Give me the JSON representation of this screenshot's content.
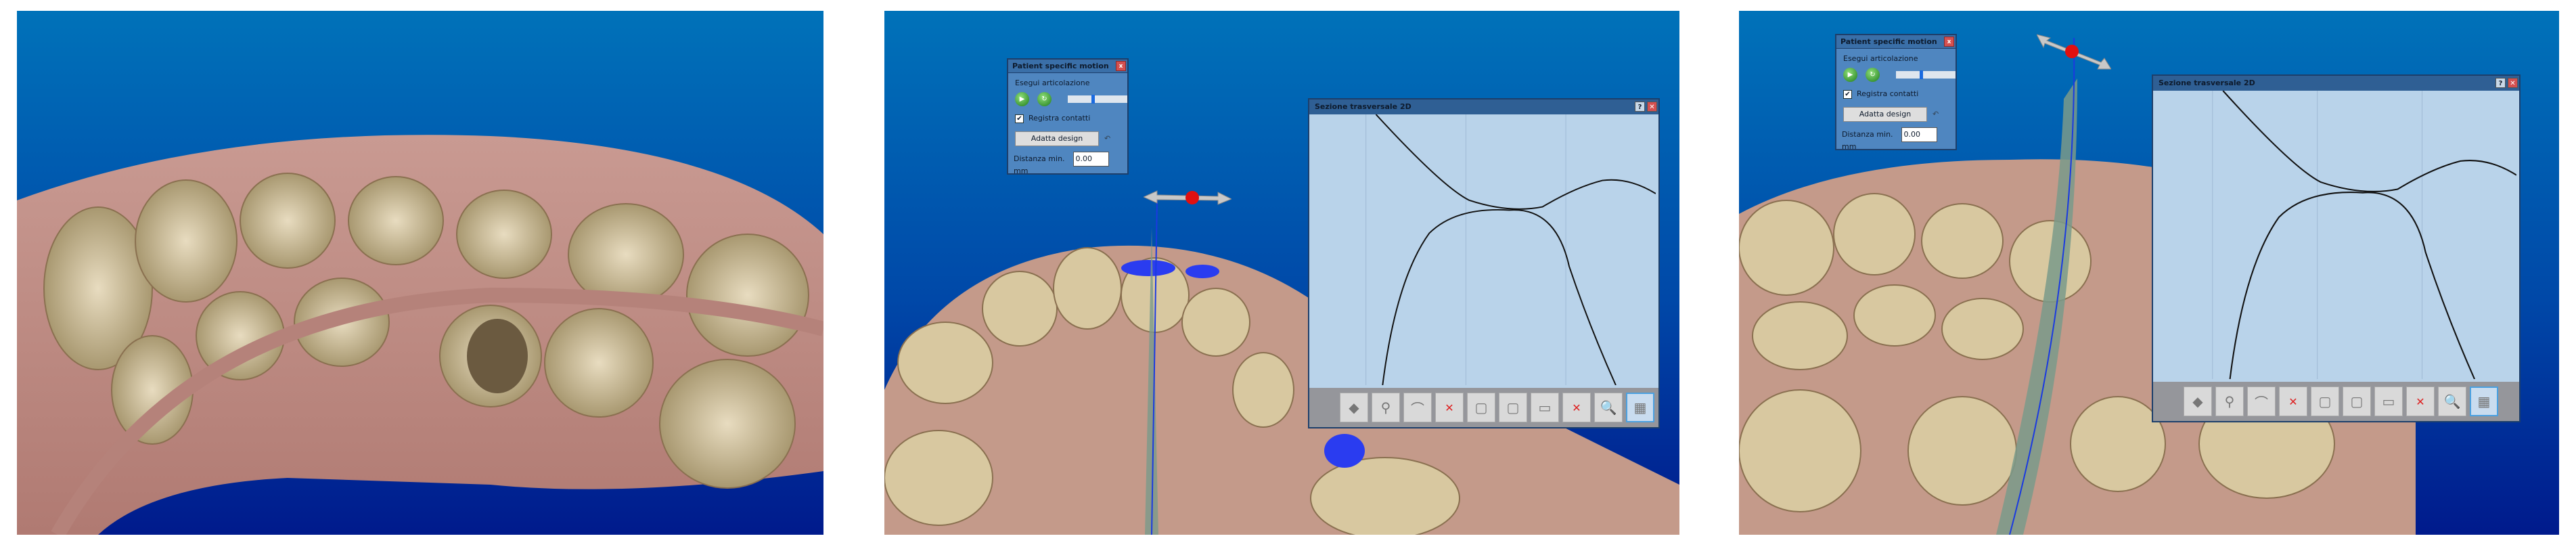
{
  "panels": [
    {
      "name": "occlusal-view"
    },
    {
      "name": "motion-view"
    },
    {
      "name": "motion-view-2"
    }
  ],
  "motion_dialog": {
    "title": "Patient specific motion",
    "close": "x",
    "section_label": "Esegui articolazione",
    "play_icon": "play-icon",
    "reset_icon": "refresh-icon",
    "slider_value": 0.4,
    "checkbox_label": "Registra contatti",
    "checkbox_checked": true,
    "adapt_button": "Adatta design",
    "distance_label": "Distanza min.",
    "distance_value": "0.00",
    "unit": "mm"
  },
  "section_window": {
    "title": "Sezione trasversale 2D",
    "help": "?",
    "close": "✕",
    "tools": [
      "surface-tool",
      "axis-tool",
      "cap-tool",
      "remove-cap-tool",
      "tooth-light-tool",
      "tooth-tool",
      "thickness-tool",
      "remove-connector-tool",
      "magnifier-tool",
      "grid-tool"
    ]
  },
  "colors": {
    "background_top": "#0072b9",
    "background_bottom": "#001a8c",
    "contact": "#2a3cf0",
    "widget_ball": "#e01010"
  }
}
